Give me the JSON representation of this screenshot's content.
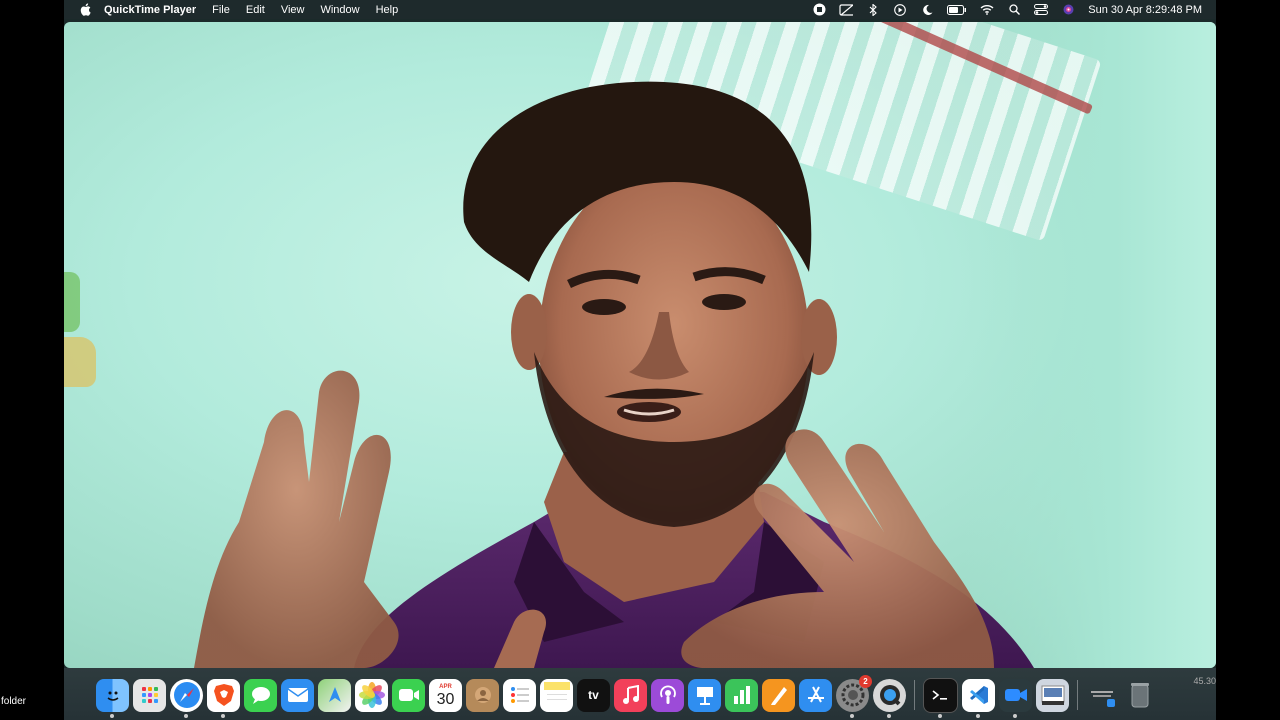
{
  "menubar": {
    "app_name": "QuickTime Player",
    "menus": [
      "File",
      "Edit",
      "View",
      "Window",
      "Help"
    ],
    "clock": "Sun 30 Apr  8:29:48 PM",
    "status_icons": [
      "record-stop-icon",
      "screen-mirroring-off-icon",
      "bluetooth-icon",
      "play-circle-icon",
      "moon-icon",
      "battery-icon",
      "wifi-icon",
      "search-icon",
      "control-center-icon",
      "siri-icon"
    ]
  },
  "dock": {
    "calendar_month": "APR",
    "calendar_day": "30",
    "tv_label": "tv",
    "settings_badge": "2",
    "items": [
      {
        "name": "finder",
        "color": "#2f8ef0"
      },
      {
        "name": "launchpad",
        "color": "#e6e6e6"
      },
      {
        "name": "safari",
        "color": "#2b8cf2"
      },
      {
        "name": "brave",
        "color": "#ffffff"
      },
      {
        "name": "messages",
        "color": "#3bd150"
      },
      {
        "name": "mail",
        "color": "#2f8ef0"
      },
      {
        "name": "maps",
        "color": "#5cc05a"
      },
      {
        "name": "photos",
        "color": "#ffffff"
      },
      {
        "name": "facetime",
        "color": "#3bd150"
      },
      {
        "name": "calendar",
        "color": "#ffffff"
      },
      {
        "name": "contacts",
        "color": "#b58a5a"
      },
      {
        "name": "reminders",
        "color": "#ffffff"
      },
      {
        "name": "notes",
        "color": "#fbe26a"
      },
      {
        "name": "apple-tv",
        "color": "#111111"
      },
      {
        "name": "music",
        "color": "#f2405a"
      },
      {
        "name": "podcasts",
        "color": "#9c4bd8"
      },
      {
        "name": "keynote",
        "color": "#2f8ef0"
      },
      {
        "name": "numbers",
        "color": "#3bc45a"
      },
      {
        "name": "pages",
        "color": "#f5951f"
      },
      {
        "name": "app-store",
        "color": "#2f8ef0"
      },
      {
        "name": "system-settings",
        "color": "#8a8a8a"
      },
      {
        "name": "quicktime",
        "color": "#d8d8d8"
      },
      {
        "name": "terminal",
        "color": "#111111"
      },
      {
        "name": "vscode",
        "color": "#ffffff"
      },
      {
        "name": "zoom",
        "color": "#2d8cff"
      },
      {
        "name": "preview",
        "color": "#cfd6e0"
      }
    ]
  },
  "desktop": {
    "folder_label": "folder",
    "timecode": "45.30"
  }
}
